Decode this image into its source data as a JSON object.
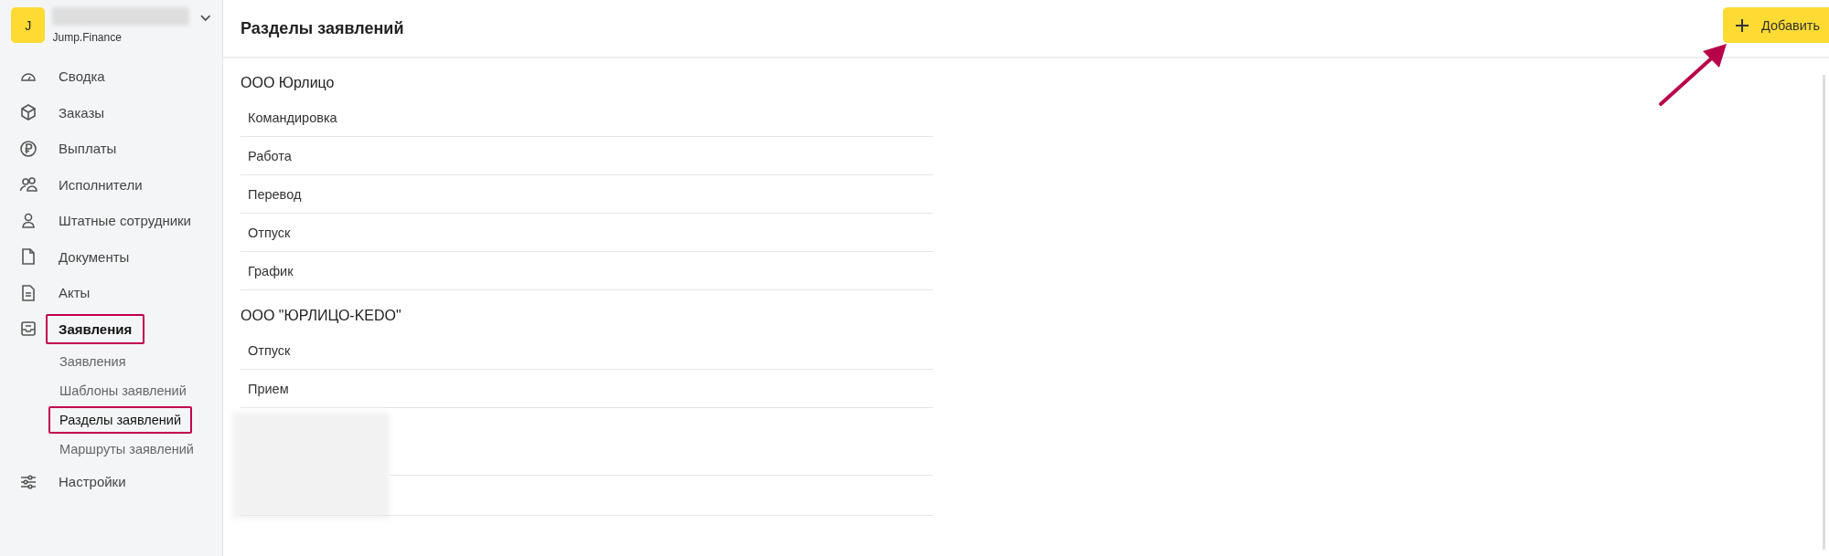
{
  "workspace": {
    "avatar_letter": "J",
    "subtitle": "Jump.Finance"
  },
  "sidebar": {
    "items": [
      {
        "label": "Сводка",
        "selected": false,
        "highlighted": false
      },
      {
        "label": "Заказы",
        "selected": false,
        "highlighted": false
      },
      {
        "label": "Выплаты",
        "selected": false,
        "highlighted": false
      },
      {
        "label": "Исполнители",
        "selected": false,
        "highlighted": false
      },
      {
        "label": "Штатные сотрудники",
        "selected": false,
        "highlighted": false
      },
      {
        "label": "Документы",
        "selected": false,
        "highlighted": false
      },
      {
        "label": "Акты",
        "selected": false,
        "highlighted": false
      },
      {
        "label": "Заявления",
        "selected": true,
        "highlighted": true,
        "expanded": true,
        "children": [
          {
            "label": "Заявления",
            "selected": false,
            "highlighted": false
          },
          {
            "label": "Шаблоны заявлений",
            "selected": false,
            "highlighted": false
          },
          {
            "label": "Разделы заявлений",
            "selected": true,
            "highlighted": true
          },
          {
            "label": "Маршруты заявлений",
            "selected": false,
            "highlighted": false
          }
        ]
      },
      {
        "label": "Настройки",
        "selected": false,
        "highlighted": false
      }
    ]
  },
  "header": {
    "title": "Разделы заявлений",
    "add_button": "Добавить"
  },
  "sections": [
    {
      "title": "ООО Юрлицо",
      "rows": [
        "Командировка",
        "Работа",
        "Перевод",
        "Отпуск",
        "График"
      ]
    },
    {
      "title": "ООО \"ЮРЛИЦО-KEDO\"",
      "rows": [
        "Отпуск",
        "Прием"
      ]
    }
  ]
}
